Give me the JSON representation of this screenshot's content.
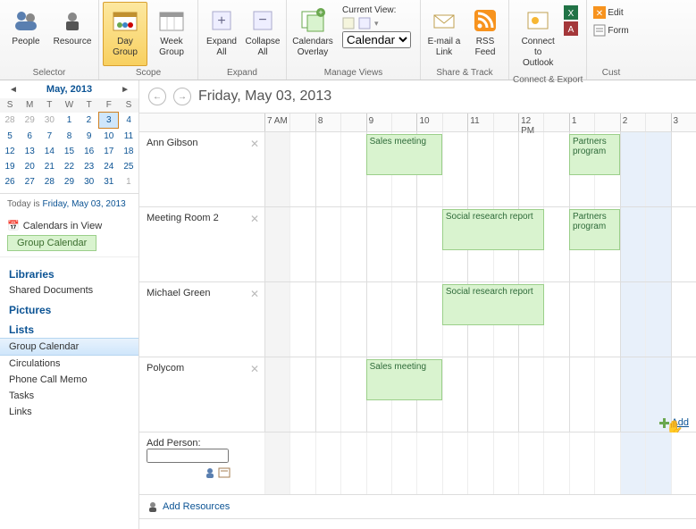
{
  "ribbon": {
    "selector": {
      "label": "Selector",
      "people": "People",
      "resource": "Resource"
    },
    "scope": {
      "label": "Scope",
      "day": "Day\nGroup",
      "week": "Week\nGroup"
    },
    "expand": {
      "label": "Expand",
      "expand_all": "Expand\nAll",
      "collapse_all": "Collapse\nAll"
    },
    "manage": {
      "label": "Manage Views",
      "overlay": "Calendars\nOverlay",
      "current_view_label": "Current View:",
      "view_value": "Calendar"
    },
    "share": {
      "label": "Share & Track",
      "email": "E-mail a\nLink",
      "rss": "RSS\nFeed"
    },
    "connect": {
      "label": "Connect & Export",
      "outlook": "Connect to\nOutlook"
    },
    "cust": {
      "label": "Cust",
      "edit": "Edit",
      "form": "Form"
    }
  },
  "picker": {
    "month": "May, 2013",
    "dow": [
      "S",
      "M",
      "T",
      "W",
      "T",
      "F",
      "S"
    ],
    "weeks": [
      [
        {
          "d": "28",
          "dim": true
        },
        {
          "d": "29",
          "dim": true
        },
        {
          "d": "30",
          "dim": true
        },
        {
          "d": "1"
        },
        {
          "d": "2"
        },
        {
          "d": "3",
          "sel": true,
          "today": true
        },
        {
          "d": "4"
        }
      ],
      [
        {
          "d": "5"
        },
        {
          "d": "6"
        },
        {
          "d": "7"
        },
        {
          "d": "8"
        },
        {
          "d": "9"
        },
        {
          "d": "10"
        },
        {
          "d": "11"
        }
      ],
      [
        {
          "d": "12"
        },
        {
          "d": "13"
        },
        {
          "d": "14"
        },
        {
          "d": "15"
        },
        {
          "d": "16"
        },
        {
          "d": "17"
        },
        {
          "d": "18"
        }
      ],
      [
        {
          "d": "19"
        },
        {
          "d": "20"
        },
        {
          "d": "21"
        },
        {
          "d": "22"
        },
        {
          "d": "23"
        },
        {
          "d": "24"
        },
        {
          "d": "25"
        }
      ],
      [
        {
          "d": "26"
        },
        {
          "d": "27"
        },
        {
          "d": "28"
        },
        {
          "d": "29"
        },
        {
          "d": "30"
        },
        {
          "d": "31"
        },
        {
          "d": "1",
          "dim": true
        }
      ]
    ],
    "today_prefix": "Today is ",
    "today_link": "Friday, May 03, 2013"
  },
  "cals": {
    "header": "Calendars in View",
    "chip": "Group Calendar"
  },
  "nav": {
    "libraries": "Libraries",
    "shared_docs": "Shared Documents",
    "pictures": "Pictures",
    "lists": "Lists",
    "items": [
      "Group Calendar",
      "Circulations",
      "Phone Call Memo",
      "Tasks",
      "Links"
    ]
  },
  "cal": {
    "title": "Friday, May 03, 2013",
    "hours": [
      "7 AM",
      "",
      "8",
      "",
      "9",
      "",
      "10",
      "",
      "11",
      "",
      "12 PM",
      "",
      "1",
      "",
      "2",
      "",
      "3"
    ],
    "rows": [
      {
        "name": "Ann Gibson",
        "events": [
          {
            "label": "Sales meeting",
            "start": 4,
            "span": 3
          },
          {
            "label": "Partners program",
            "start": 12,
            "span": 2
          }
        ]
      },
      {
        "name": "Meeting Room 2",
        "events": [
          {
            "label": "Social research report",
            "start": 7,
            "span": 4
          },
          {
            "label": "Partners program",
            "start": 12,
            "span": 2
          }
        ]
      },
      {
        "name": "Michael Green",
        "events": [
          {
            "label": "Social research report",
            "start": 7,
            "span": 4
          }
        ]
      },
      {
        "name": "Polycom",
        "events": [
          {
            "label": "Sales meeting",
            "start": 4,
            "span": 3
          }
        ]
      }
    ],
    "add_person_label": "Add Person:",
    "add_link": "Add",
    "add_resources": "Add Resources"
  }
}
